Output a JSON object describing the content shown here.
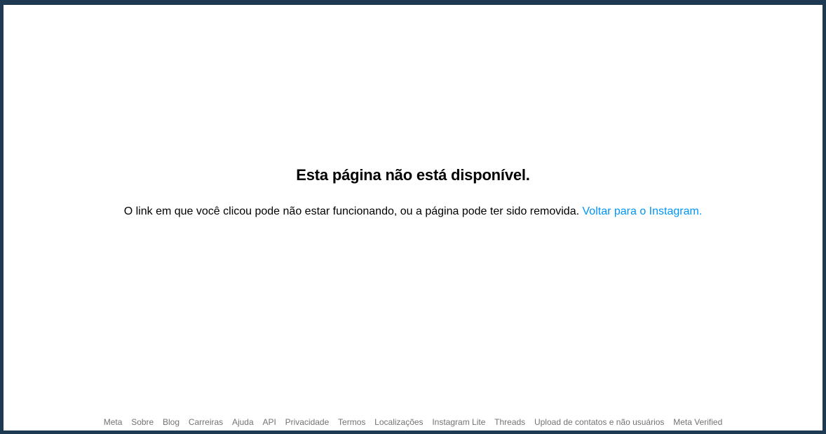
{
  "error": {
    "title": "Esta página não está disponível.",
    "message": "O link em que você clicou pode não estar funcionando, ou a página pode ter sido removida.",
    "back_link": "Voltar para o Instagram."
  },
  "footer": {
    "links": [
      "Meta",
      "Sobre",
      "Blog",
      "Carreiras",
      "Ajuda",
      "API",
      "Privacidade",
      "Termos",
      "Localizações",
      "Instagram Lite",
      "Threads",
      "Upload de contatos e não usuários",
      "Meta Verified"
    ]
  },
  "colors": {
    "link": "#0095f6",
    "footer_text": "#737373",
    "frame_border": "#1e3a52"
  }
}
